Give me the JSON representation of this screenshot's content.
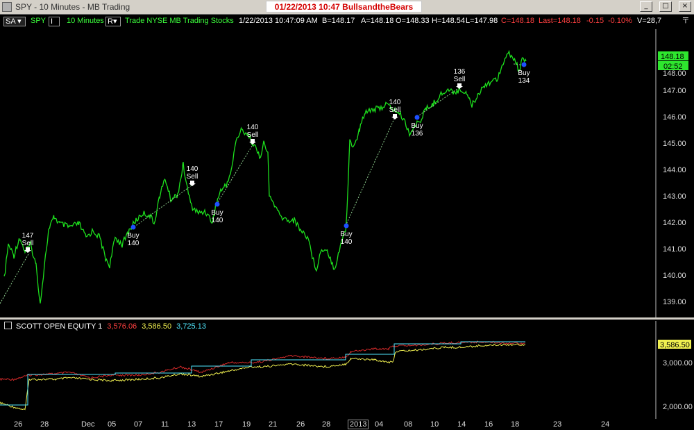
{
  "window": {
    "title": "SPY - 10 Minutes - MB Trading",
    "stamp": "01/22/2013  10:47   BullsandtheBears",
    "buttons": [
      "_",
      "□",
      "×"
    ]
  },
  "toolbar": {
    "template": "SA",
    "symbol": "SPY",
    "symbol_box": "I",
    "interval": "10 Minutes",
    "range_box": "R",
    "feed": "Trade  NYSE  MB Trading  Stocks",
    "datetime": "1/22/2013  10:47:09 AM",
    "bid": "B=148.17",
    "ask": "A=148.18",
    "open": "O=148.33",
    "high": "H=148.54",
    "low": "L=147.98",
    "close": "C=148.18",
    "last": "Last=148.18",
    "change": "-0.15",
    "change_pct": "-0.10%",
    "volume": "V=28,7"
  },
  "price_axis": {
    "labels": [
      "139.00",
      "140.00",
      "141.00",
      "142.00",
      "143.00",
      "144.00",
      "145.00",
      "146.00",
      "147.00",
      "148.00"
    ],
    "last_price_tag": "148.18",
    "countdown_tag": "02:52"
  },
  "signals": [
    {
      "side": "Sell",
      "qty": "147"
    },
    {
      "side": "Buy",
      "qty": "140"
    },
    {
      "side": "Sell",
      "qty": "140"
    },
    {
      "side": "Buy",
      "qty": "140"
    },
    {
      "side": "Sell",
      "qty": "140"
    },
    {
      "side": "Buy",
      "qty": "140"
    },
    {
      "side": "Sell",
      "qty": "140"
    },
    {
      "side": "Buy",
      "qty": "136"
    },
    {
      "side": "Sell",
      "qty": "136"
    },
    {
      "side": "Buy",
      "qty": "134"
    }
  ],
  "equity_panel": {
    "indicator_name": "SCOTT OPEN EQUITY 1",
    "value_red": "3,576.06",
    "value_yellow": "3,586.50",
    "value_cyan": "3,725.13",
    "axis_labels": [
      "2,000.00",
      "3,000.00"
    ],
    "tag_yellow": "3,586.50"
  },
  "x_axis": {
    "labels": [
      "26",
      "28",
      "Dec",
      "05",
      "07",
      "11",
      "13",
      "17",
      "19",
      "21",
      "26",
      "28",
      "2013",
      "04",
      "08",
      "10",
      "14",
      "16",
      "18",
      "23",
      "24"
    ]
  },
  "colors": {
    "price": "#1de01d",
    "trade_line": "#8fcf8f",
    "equity_red": "#d42a2a",
    "equity_yellow": "#f0f050",
    "equity_cyan": "#50e8ff",
    "signal_marker": "#1e50ff"
  }
}
